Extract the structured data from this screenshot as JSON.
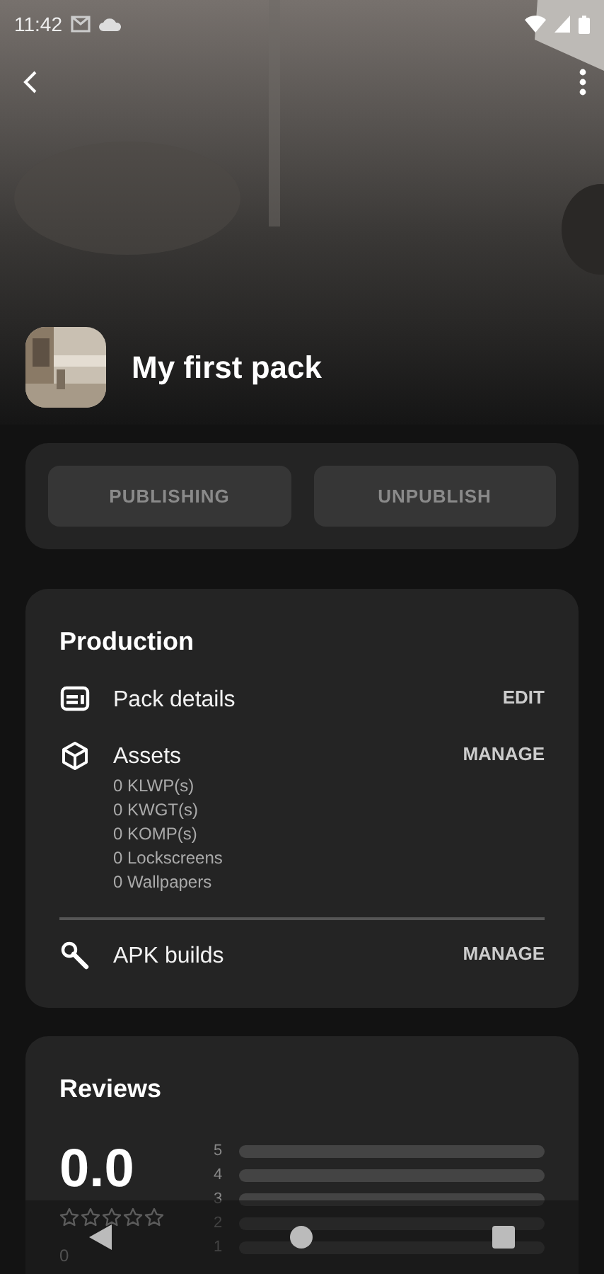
{
  "status_bar": {
    "time": "11:42"
  },
  "header": {
    "title": "My first pack"
  },
  "publish_buttons": [
    {
      "label": "PUBLISHING",
      "disabled": true
    },
    {
      "label": "UNPUBLISH",
      "disabled": true
    }
  ],
  "production": {
    "title": "Production",
    "items": [
      {
        "kind": "details",
        "label": "Pack details",
        "action": "EDIT",
        "divider_above": false
      },
      {
        "kind": "assets",
        "label": "Assets",
        "action": "MANAGE",
        "divider_above": false,
        "details": [
          "0 KLWP(s)",
          "0 KWGT(s)",
          "0 KOMP(s)",
          "0 Lockscreens",
          "0 Wallpapers"
        ]
      },
      {
        "kind": "builds",
        "label": "APK builds",
        "action": "MANAGE",
        "divider_above": true
      }
    ]
  },
  "reviews": {
    "title": "Reviews",
    "average": "0.0",
    "stars": 0,
    "count": "0",
    "histogram": [
      {
        "label": "5",
        "level": 0
      },
      {
        "label": "4",
        "level": 0
      },
      {
        "label": "3",
        "level": 0
      },
      {
        "label": "2",
        "level": 0
      },
      {
        "label": "1",
        "level": 0
      }
    ]
  }
}
